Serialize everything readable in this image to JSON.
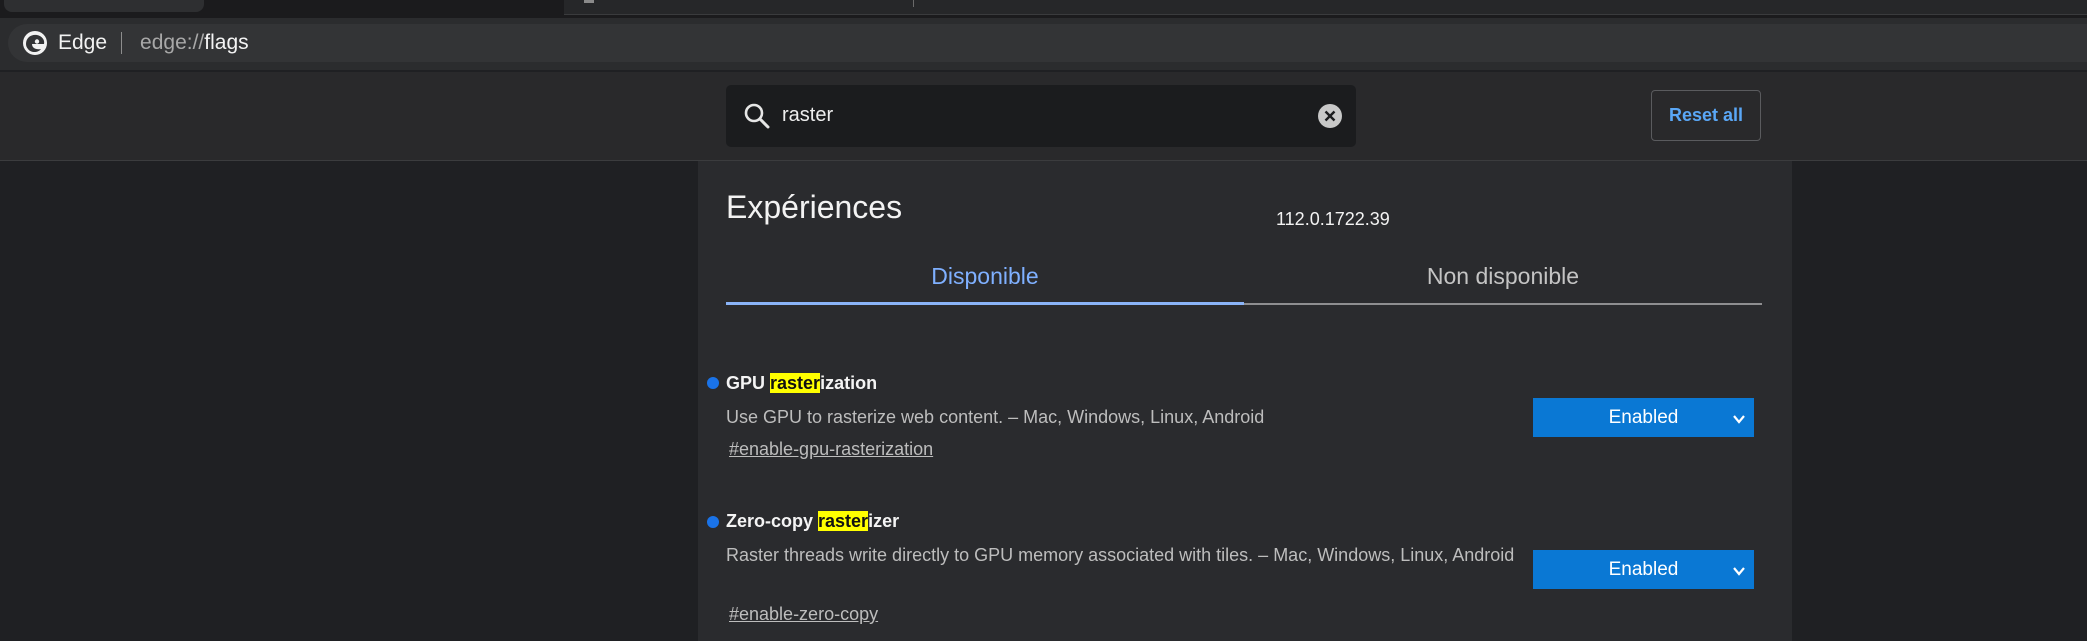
{
  "browser": {
    "brand": "Edge",
    "url_scheme": "edge://",
    "url_path": "flags"
  },
  "header": {
    "search_value": "raster",
    "reset_label": "Reset all"
  },
  "page": {
    "title": "Expériences",
    "version": "112.0.1722.39"
  },
  "tabs": [
    {
      "label": "Disponible",
      "active": true
    },
    {
      "label": "Non disponible",
      "active": false
    }
  ],
  "flags": [
    {
      "name_before": "GPU ",
      "name_highlight": "raster",
      "name_after": "ization",
      "description": "Use GPU to rasterize web content. – Mac, Windows, Linux, Android",
      "anchor": "#enable-gpu-rasterization",
      "value": "Enabled"
    },
    {
      "name_before": "Zero-copy ",
      "name_highlight": "raster",
      "name_after": "izer",
      "description": "Raster threads write directly to GPU memory associated with tiles. – Mac, Windows, Linux, Android",
      "anchor": "#enable-zero-copy",
      "value": "Enabled"
    }
  ],
  "colors": {
    "accent_blue": "#0a78d4",
    "link_blue": "#5aa7f6",
    "tab_active": "#7fb0ff",
    "highlight": "#ffff00",
    "flag_dot": "#1a73e8"
  },
  "icons": [
    "edge-logo-icon",
    "search-icon",
    "clear-icon",
    "chevron-down-icon"
  ]
}
